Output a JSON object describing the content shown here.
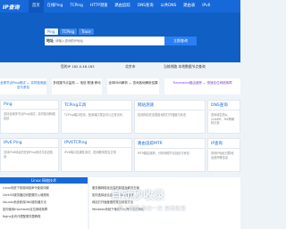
{
  "nav": {
    "logo": "IP查询",
    "items": [
      "首页",
      "在线Ping",
      "TCPing",
      "HTTP测速",
      "路由追踪",
      "DNS查询",
      "公共DNS",
      "路由表",
      "IPv6"
    ]
  },
  "search": {
    "tabs": [
      "Ping",
      "TCPing",
      "Trace"
    ],
    "label": "地址",
    "placeholder": "请输入查询的IP地址",
    "button": "立即查询"
  },
  "ipline": {
    "ip": "您的IP 182.0.48.183",
    "location": "北京市",
    "isp": "当前线路 本地数据节点查询"
  },
  "banners": [
    "全球节点Ping测试 — 实时检测延迟与丢包",
    "多线路节点监测 — 电信 联通 移动",
    "全球DNS解析 — 查询各地解析结果",
    "Traceroute路由追踪 — 快速定位网络故障"
  ],
  "cards": [
    {
      "title": "Ping",
      "desc": "支持全球多节点Ping测试，实时检测网络延迟"
    },
    {
      "title": "TCPing工具",
      "desc": "TCPing端口检测，检测端口是否可以正常访问"
    },
    {
      "title": "网站测速",
      "desc": "检测网站在全国各地的打开速度与状态"
    },
    {
      "title": "DNS查询",
      "desc": "查询域名的A、CNAME、MX等解析记录"
    },
    {
      "title": "IPv6 Ping",
      "desc": "支持IPv6地址的在线Ping测试与延迟检测"
    },
    {
      "title": "IPV6TCPing",
      "desc": "IPv6端口连通性测试，检测服务是否正常"
    },
    {
      "title": "路由追踪MTR",
      "desc": "MTR路由追踪，分析网络节点延迟与丢包"
    },
    {
      "title": "IP查询",
      "desc": "查询IP地址归属地、运营商等信息"
    }
  ],
  "linux": {
    "header": "Linux 网络技术",
    "lines": [
      "Linux系统下常用网络命令使用详解",
      "CentOS服务器如何配置防火墙规则",
      "Ubuntu系统修改DNS服务器方法",
      "如何使用traceroute定位网络故障",
      "Nginx反向代理配置完整教程"
    ]
  },
  "articles": {
    "lines": [
      "服务器网络延迟高的原因及解决方案",
      "如何选择适合自己的CDN加速服务",
      "网站打开速度慢的常见排查方法",
      "Windows系统下使用Ping命令检测网络"
    ]
  },
  "watermark": {
    "line1": "自动秒收录",
    "line2": "数上链接 来访一次 自动收录"
  }
}
